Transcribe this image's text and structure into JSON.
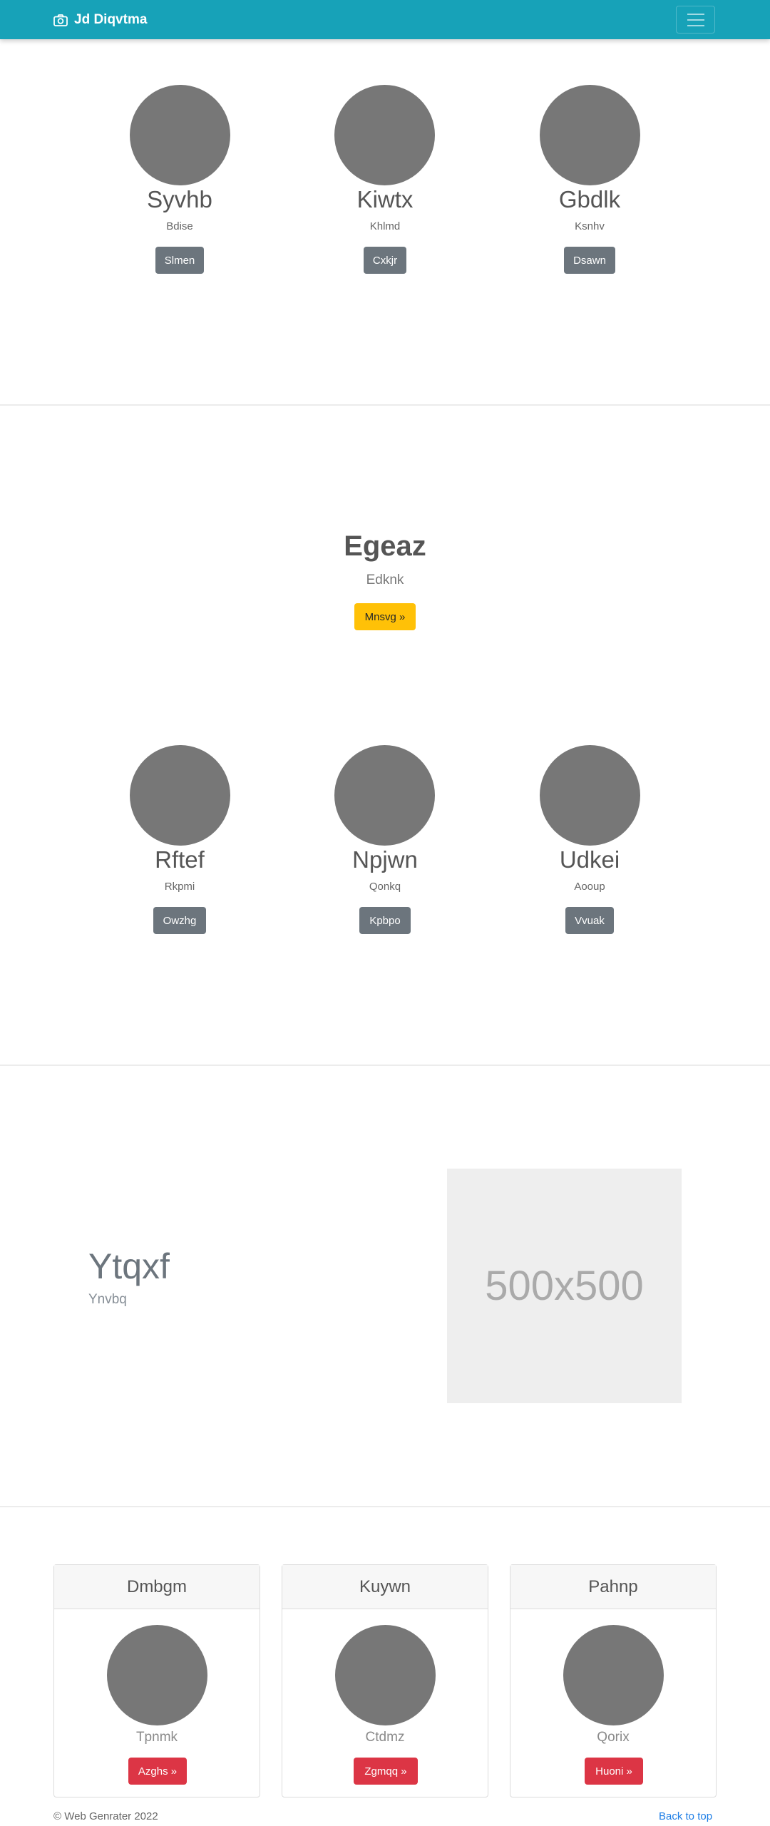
{
  "navbar": {
    "brand": "Jd Diqvtma",
    "brand_icon": "camera-icon",
    "menu_icon": "hamburger-menu-icon",
    "color": "#17a2b8"
  },
  "team_top": [
    {
      "name": "Syvhb",
      "role": "Bdise",
      "button": "Slmen"
    },
    {
      "name": "Kiwtx",
      "role": "Khlmd",
      "button": "Cxkjr"
    },
    {
      "name": "Gbdlk",
      "role": "Ksnhv",
      "button": "Dsawn"
    }
  ],
  "jumbotron": {
    "title": "Egeaz",
    "subtitle": "Edknk",
    "button": "Mnsvg »"
  },
  "team_bottom": [
    {
      "name": "Rftef",
      "role": "Rkpmi",
      "button": "Owzhg"
    },
    {
      "name": "Npjwn",
      "role": "Qonkq",
      "button": "Kpbpo"
    },
    {
      "name": "Udkei",
      "role": "Aooup",
      "button": "Vvuak"
    }
  ],
  "feature": {
    "title": "Ytqxf",
    "subtitle": "Ynvbq",
    "image_label": "500x500"
  },
  "cards": [
    {
      "header": "Dmbgm",
      "text": "Tpnmk",
      "button": "Azghs »"
    },
    {
      "header": "Kuywn",
      "text": "Ctdmz",
      "button": "Zgmqq »"
    },
    {
      "header": "Pahnp",
      "text": "Qorix",
      "button": "Huoni »"
    }
  ],
  "footer": {
    "copyright": "© Web Genrater 2022",
    "back_to_top": "Back to top"
  },
  "colors": {
    "gray_button": "#6c757d",
    "yellow_button": "#ffc107",
    "red_button": "#dc3545",
    "link": "#1e7ee6"
  }
}
